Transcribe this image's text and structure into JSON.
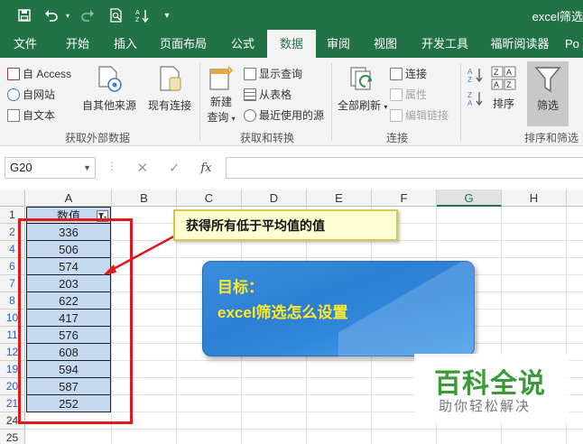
{
  "titlebar": {
    "title": "excel筛选",
    "quick_access": [
      "save-icon",
      "undo-icon",
      "redo-icon",
      "print-preview-icon",
      "sort-icon",
      "customize-icon"
    ]
  },
  "tabs": [
    "文件",
    "开始",
    "插入",
    "页面布局",
    "公式",
    "数据",
    "审阅",
    "视图",
    "开发工具",
    "福昕阅读器",
    "Po"
  ],
  "active_tab": "数据",
  "ribbon": {
    "get_external": {
      "access": "自 Access",
      "web": "自网站",
      "text": "自文本",
      "other": "自其他来源",
      "existing": "现有连接",
      "group_label": "获取外部数据"
    },
    "get_transform": {
      "new_query": "新建",
      "new_query2": "查询",
      "show_queries": "显示查询",
      "from_table": "从表格",
      "recent_sources": "最近使用的源",
      "group_label": "获取和转换"
    },
    "connections": {
      "refresh_all": "全部刷新",
      "connections": "连接",
      "properties": "属性",
      "edit_links": "编辑链接",
      "group_label": "连接"
    },
    "sort_filter": {
      "sort": "排序",
      "filter": "筛选",
      "group_label": "排序和筛选"
    }
  },
  "formula_bar": {
    "name_box": "G20",
    "fx": "fx",
    "formula": ""
  },
  "sheet": {
    "columns": [
      "A",
      "B",
      "C",
      "D",
      "E",
      "F",
      "G",
      "H"
    ],
    "selected_column": "G",
    "header_value": "数值",
    "rows": [
      {
        "row": "1",
        "value": ""
      },
      {
        "row": "2",
        "value": "336"
      },
      {
        "row": "4",
        "value": "506"
      },
      {
        "row": "6",
        "value": "574"
      },
      {
        "row": "7",
        "value": "203"
      },
      {
        "row": "8",
        "value": "622"
      },
      {
        "row": "10",
        "value": "417"
      },
      {
        "row": "11",
        "value": "576"
      },
      {
        "row": "12",
        "value": "608"
      },
      {
        "row": "19",
        "value": "594"
      },
      {
        "row": "20",
        "value": "587"
      },
      {
        "row": "21",
        "value": "252"
      },
      {
        "row": "24",
        "value": ""
      },
      {
        "row": "25",
        "value": ""
      }
    ]
  },
  "annotations": {
    "callout": "获得所有低于平均值的值",
    "goal_label": "目标：",
    "goal_text": "excel筛选怎么设置"
  },
  "watermark": {
    "main": "百科全说",
    "sub": "助你轻松解决"
  },
  "colors": {
    "excel_green": "#217346",
    "data_fill": "#c5d9f1",
    "annotation_red": "#e0191b",
    "goal_yellow": "#ffea2a",
    "watermark_green": "#3a9a3a"
  }
}
